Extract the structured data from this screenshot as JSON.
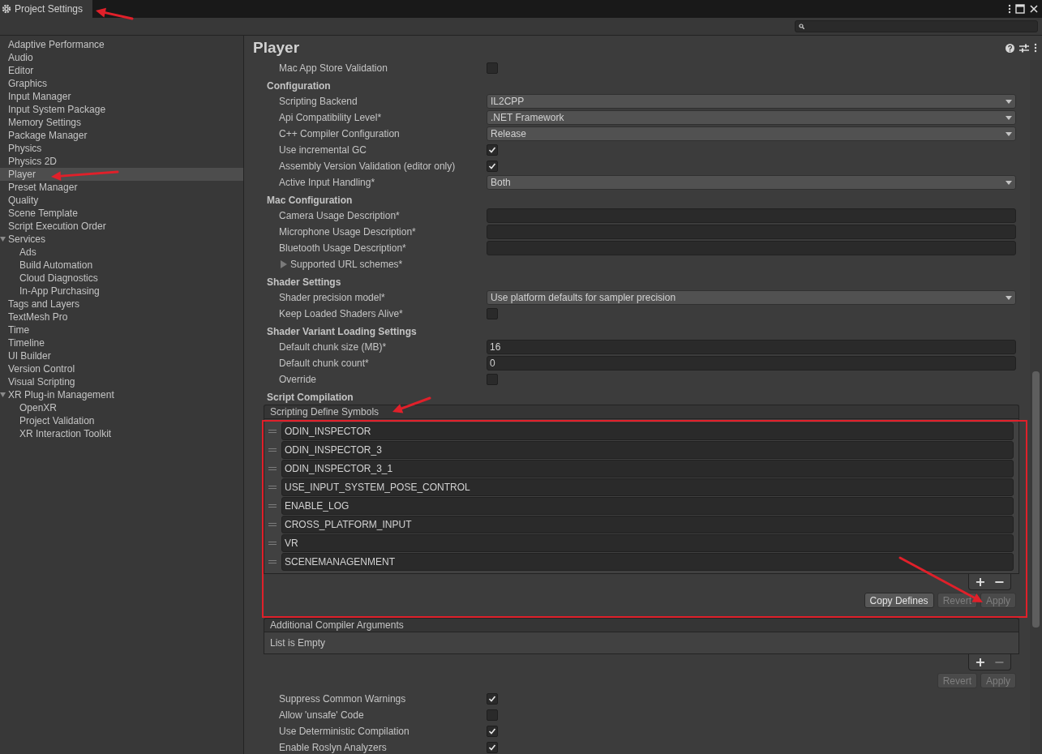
{
  "window": {
    "tab": "Project Settings"
  },
  "sidebar": {
    "items": [
      {
        "label": "Adaptive Performance",
        "selected": false
      },
      {
        "label": "Audio",
        "selected": false
      },
      {
        "label": "Editor",
        "selected": false
      },
      {
        "label": "Graphics",
        "selected": false
      },
      {
        "label": "Input Manager",
        "selected": false
      },
      {
        "label": "Input System Package",
        "selected": false
      },
      {
        "label": "Memory Settings",
        "selected": false
      },
      {
        "label": "Package Manager",
        "selected": false
      },
      {
        "label": "Physics",
        "selected": false
      },
      {
        "label": "Physics 2D",
        "selected": false
      },
      {
        "label": "Player",
        "selected": true
      },
      {
        "label": "Preset Manager",
        "selected": false
      },
      {
        "label": "Quality",
        "selected": false
      },
      {
        "label": "Scene Template",
        "selected": false
      },
      {
        "label": "Script Execution Order",
        "selected": false
      },
      {
        "label": "Services",
        "selected": false,
        "expanded": true,
        "children": [
          {
            "label": "Ads",
            "selected": false
          },
          {
            "label": "Build Automation",
            "selected": false
          },
          {
            "label": "Cloud Diagnostics",
            "selected": false
          },
          {
            "label": "In-App Purchasing",
            "selected": false
          }
        ]
      },
      {
        "label": "Tags and Layers",
        "selected": false
      },
      {
        "label": "TextMesh Pro",
        "selected": false
      },
      {
        "label": "Time",
        "selected": false
      },
      {
        "label": "Timeline",
        "selected": false
      },
      {
        "label": "UI Builder",
        "selected": false
      },
      {
        "label": "Version Control",
        "selected": false
      },
      {
        "label": "Visual Scripting",
        "selected": false
      },
      {
        "label": "XR Plug-in Management",
        "selected": false,
        "expanded": true,
        "children": [
          {
            "label": "OpenXR",
            "selected": false
          },
          {
            "label": "Project Validation",
            "selected": false
          },
          {
            "label": "XR Interaction Toolkit",
            "selected": false
          }
        ]
      }
    ]
  },
  "panel": {
    "title": "Player",
    "rows": [
      {
        "kind": "checkbox",
        "label": "Mac App Store Validation",
        "checked": false
      },
      {
        "kind": "heading",
        "label": "Configuration"
      },
      {
        "kind": "dropdown",
        "label": "Scripting Backend",
        "value": "IL2CPP"
      },
      {
        "kind": "dropdown",
        "label": "Api Compatibility Level*",
        "value": ".NET Framework"
      },
      {
        "kind": "dropdown",
        "label": "C++ Compiler Configuration",
        "value": "Release"
      },
      {
        "kind": "checkbox",
        "label": "Use incremental GC",
        "checked": true
      },
      {
        "kind": "checkbox",
        "label": "Assembly Version Validation (editor only)",
        "checked": true
      },
      {
        "kind": "dropdown",
        "label": "Active Input Handling*",
        "value": "Both"
      },
      {
        "kind": "heading",
        "label": "Mac Configuration"
      },
      {
        "kind": "text",
        "label": "Camera Usage Description*"
      },
      {
        "kind": "text",
        "label": "Microphone Usage Description*"
      },
      {
        "kind": "text",
        "label": "Bluetooth Usage Description*"
      },
      {
        "kind": "foldout",
        "label": "Supported URL schemes*",
        "expanded": false
      },
      {
        "kind": "heading",
        "label": "Shader Settings"
      },
      {
        "kind": "dropdown",
        "label": "Shader precision model*",
        "value": "Use platform defaults for sampler precision"
      },
      {
        "kind": "checkbox",
        "label": "Keep Loaded Shaders Alive*",
        "checked": false
      },
      {
        "kind": "heading",
        "label": "Shader Variant Loading Settings"
      },
      {
        "kind": "text",
        "label": "Default chunk size (MB)*",
        "value": "16"
      },
      {
        "kind": "text",
        "label": "Default chunk count*",
        "value": "0"
      },
      {
        "kind": "checkbox",
        "label": "Override",
        "checked": false
      },
      {
        "kind": "heading",
        "label": "Script Compilation"
      }
    ]
  },
  "define_symbols": {
    "header": "Scripting Define Symbols",
    "items": [
      "ODIN_INSPECTOR",
      "ODIN_INSPECTOR_3",
      "ODIN_INSPECTOR_3_1",
      "USE_INPUT_SYSTEM_POSE_CONTROL",
      "ENABLE_LOG",
      "CROSS_PLATFORM_INPUT",
      "VR",
      "SCENEMANAGENMENT"
    ],
    "add": {
      "label": "+",
      "disabled": false
    },
    "remove": {
      "label": "−",
      "disabled": false
    },
    "buttons": [
      {
        "label": "Copy Defines",
        "disabled": false
      },
      {
        "label": "Revert",
        "disabled": true
      },
      {
        "label": "Apply",
        "disabled": true
      }
    ]
  },
  "compiler_args": {
    "header": "Additional Compiler Arguments",
    "empty_text": "List is Empty",
    "add": {
      "label": "+",
      "disabled": false
    },
    "remove": {
      "label": "−",
      "disabled": true
    },
    "buttons": [
      {
        "label": "Revert",
        "disabled": true
      },
      {
        "label": "Apply",
        "disabled": true
      }
    ]
  },
  "options": [
    {
      "label": "Suppress Common Warnings",
      "checked": true
    },
    {
      "label": "Allow 'unsafe' Code",
      "checked": false
    },
    {
      "label": "Use Deterministic Compilation",
      "checked": true
    },
    {
      "label": "Enable Roslyn Analyzers",
      "checked": true
    }
  ]
}
